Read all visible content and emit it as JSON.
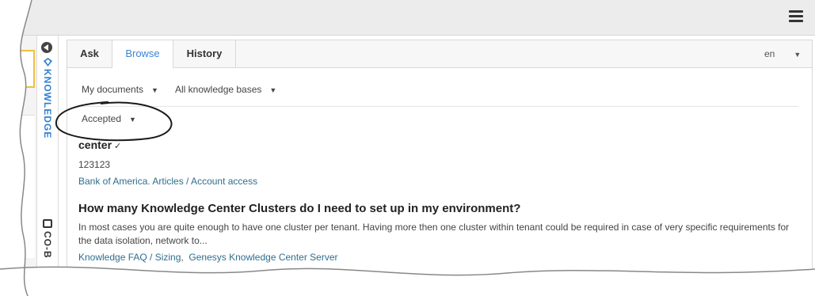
{
  "header": {
    "menu_icon": "hamburger-menu-icon"
  },
  "sidebar": {
    "collapse_icon": "collapse-arrow-icon",
    "knowledge_label": "KNOWLEDGE",
    "knowledge_icon": "knowledge-icon",
    "cobrowse_label": "CO-B",
    "cobrowse_icon": "cobrowse-icon"
  },
  "tabs": [
    {
      "label": "Ask"
    },
    {
      "label": "Browse",
      "active": true
    },
    {
      "label": "History"
    }
  ],
  "language": {
    "value": "en"
  },
  "filters": {
    "documents": "My documents",
    "knowledge_bases": "All knowledge bases",
    "status": "Accepted"
  },
  "results": [
    {
      "title": "center",
      "body": "123123",
      "links": [
        "Bank of America. Articles / Account access"
      ]
    },
    {
      "title": "How many Knowledge Center Clusters do I need to set up in my environment?",
      "body": "In most cases you are quite enough to have one cluster per tenant. Having more then one cluster within tenant could be required in case of very specific requirements for the data isolation, network to...",
      "links": [
        "Knowledge FAQ / Sizing",
        "Genesys Knowledge Center Server"
      ],
      "link_separator": ","
    }
  ],
  "colors": {
    "accent": "#3a87d6",
    "link": "#2e6e8e",
    "topbar": "#ececec"
  }
}
